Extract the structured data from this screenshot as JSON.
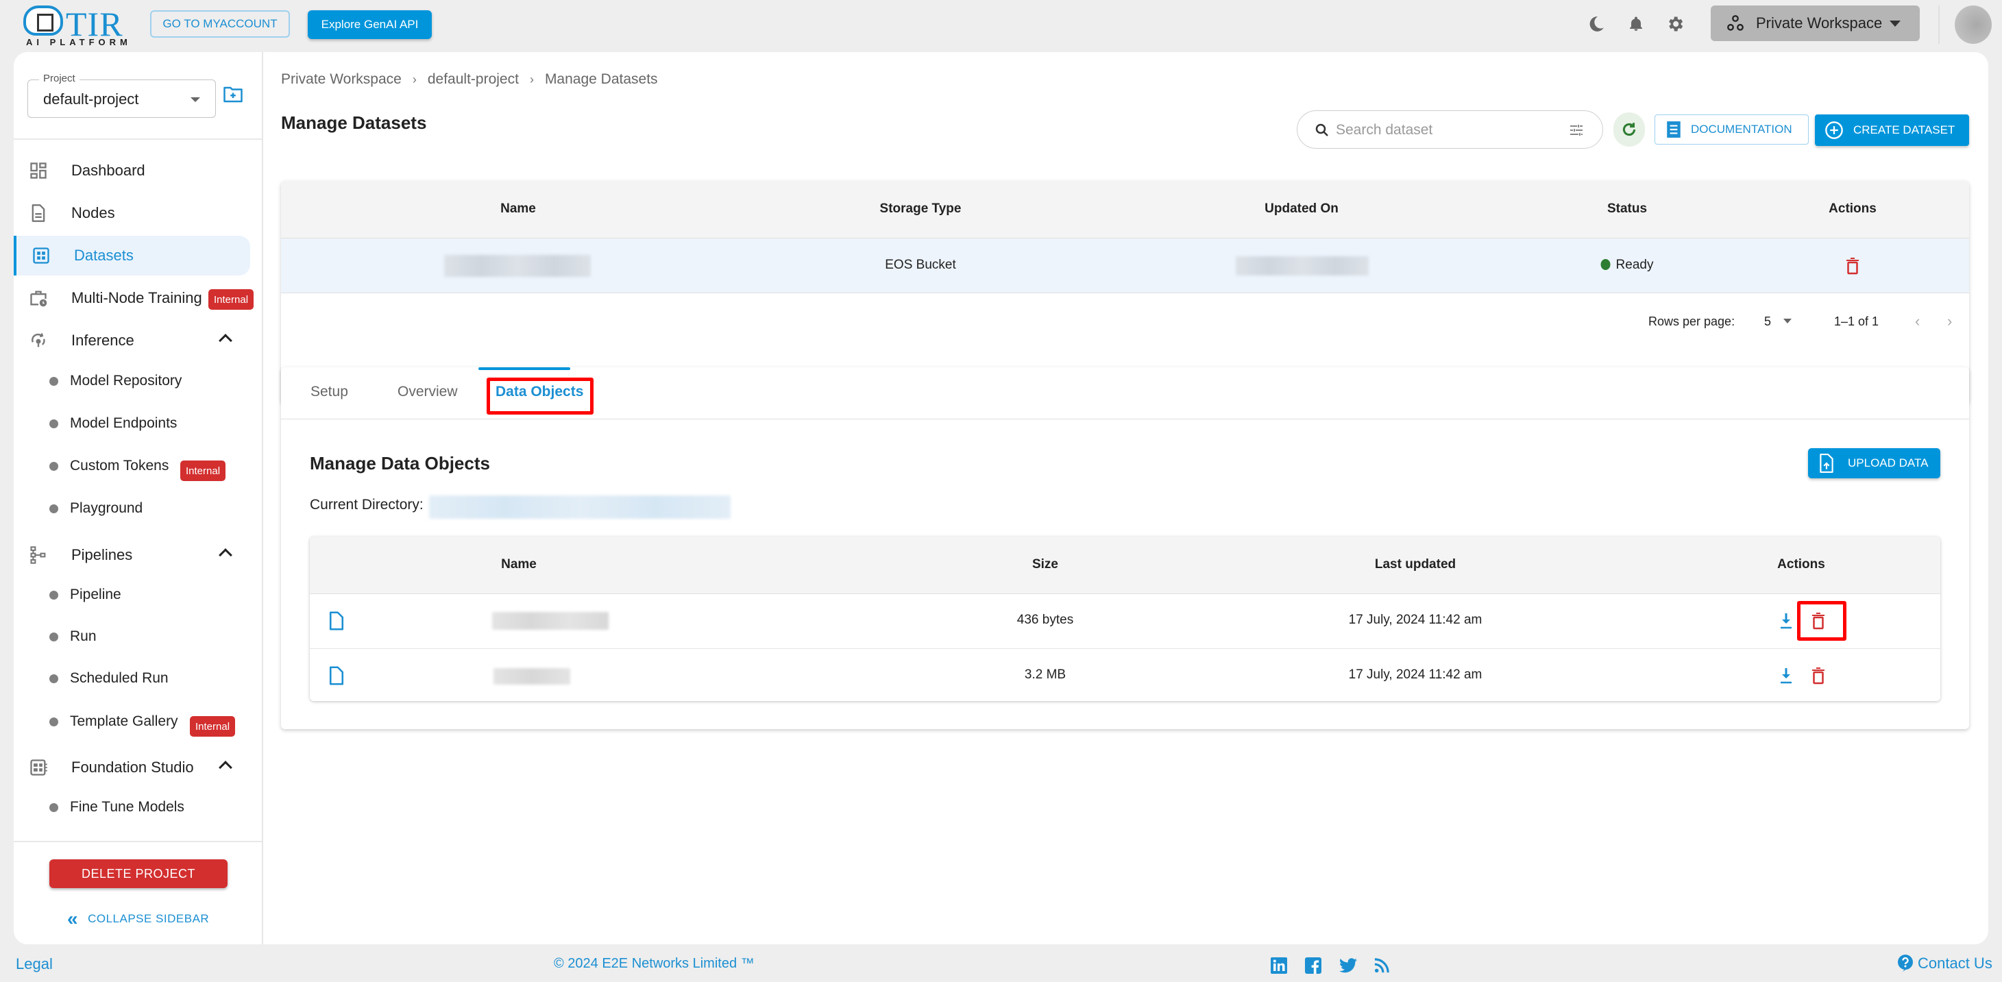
{
  "topbar": {
    "logo_title": "TIR",
    "logo_subtitle": "AI PLATFORM",
    "myaccount_label": "GO TO MYACCOUNT",
    "genai_label": "Explore GenAI API",
    "icons": [
      "moon-icon",
      "bell-icon",
      "gear-icon"
    ],
    "workspace_label": "Private Workspace"
  },
  "sidebar": {
    "project_label": "Project",
    "project_value": "default-project",
    "items": [
      {
        "label": "Dashboard",
        "icon": "dashboard-icon"
      },
      {
        "label": "Nodes",
        "icon": "file-icon"
      },
      {
        "label": "Datasets",
        "icon": "datasets-icon",
        "active": true
      },
      {
        "label": "Multi-Node Training",
        "icon": "briefcase-clock-icon",
        "badge": "Internal"
      },
      {
        "label": "Inference",
        "icon": "inference-icon",
        "expanded": true,
        "children": [
          {
            "label": "Model Repository"
          },
          {
            "label": "Model Endpoints"
          },
          {
            "label": "Custom Tokens",
            "badge": "Internal"
          },
          {
            "label": "Playground"
          }
        ]
      },
      {
        "label": "Pipelines",
        "icon": "pipeline-icon",
        "expanded": true,
        "children": [
          {
            "label": "Pipeline"
          },
          {
            "label": "Run"
          },
          {
            "label": "Scheduled Run"
          },
          {
            "label": "Template Gallery",
            "badge": "Internal"
          }
        ]
      },
      {
        "label": "Foundation Studio",
        "icon": "foundation-icon",
        "expanded": true,
        "children": [
          {
            "label": "Fine Tune Models"
          }
        ]
      }
    ],
    "delete_project_label": "DELETE PROJECT",
    "collapse_label": "COLLAPSE SIDEBAR"
  },
  "main": {
    "breadcrumb": [
      "Private Workspace",
      "default-project",
      "Manage Datasets"
    ],
    "breadcrumb_sep": "›",
    "title": "Manage Datasets",
    "search_placeholder": "Search dataset",
    "documentation_label": "DOCUMENTATION",
    "create_label": "CREATE DATASET",
    "datasets_table": {
      "columns": [
        "Name",
        "Storage Type",
        "Updated On",
        "Status",
        "Actions"
      ],
      "rows": [
        {
          "name": "[redacted]",
          "storage_type": "EOS Bucket",
          "updated_on": "[redacted]",
          "status": "Ready"
        }
      ],
      "rows_per_page_label": "Rows per page:",
      "rows_per_page": "5",
      "range": "1–1 of 1"
    },
    "tabs": [
      "Setup",
      "Overview",
      "Data Objects"
    ],
    "active_tab": "Data Objects",
    "data_objects": {
      "title": "Manage Data Objects",
      "current_directory_label": "Current Directory:",
      "current_directory": "[redacted]",
      "upload_label": "UPLOAD DATA",
      "columns": [
        "Name",
        "Size",
        "Last updated",
        "Actions"
      ],
      "rows": [
        {
          "name": "[redacted]",
          "size": "436 bytes",
          "last_updated": "17 July, 2024 11:42 am"
        },
        {
          "name": "[redacted]",
          "size": "3.2 MB",
          "last_updated": "17 July, 2024 11:42 am"
        }
      ]
    }
  },
  "footer": {
    "legal": "Legal",
    "copyright": "© 2024 E2E Networks Limited ™",
    "social": [
      "linkedin-icon",
      "facebook-icon",
      "twitter-icon",
      "rss-icon"
    ],
    "contact": "Contact Us"
  },
  "colors": {
    "accent": "#0095db",
    "link": "#1b8fd2",
    "danger": "#d32f2f",
    "success": "#2e7d32",
    "highlight": "#ff0000"
  }
}
